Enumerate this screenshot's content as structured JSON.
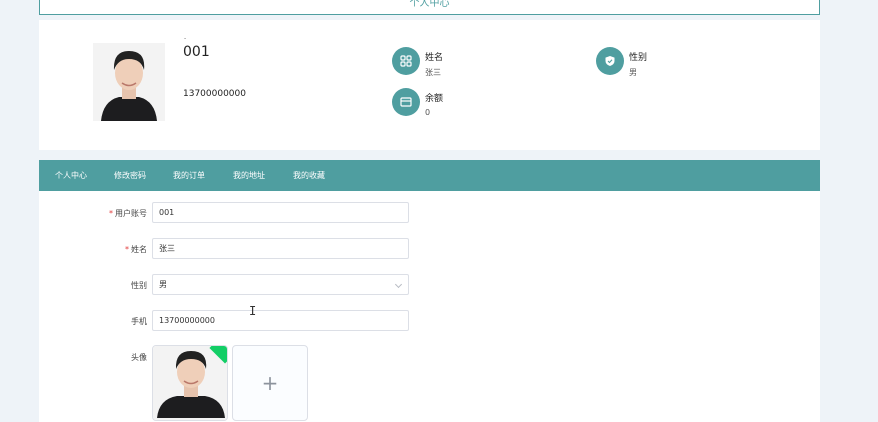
{
  "header": {
    "title": "个人中心"
  },
  "profile": {
    "mark": "-",
    "account": "001",
    "phone": "13700000000",
    "info": [
      {
        "label": "姓名",
        "value": "张三",
        "icon": "grid-icon"
      },
      {
        "label": "性别",
        "value": "男",
        "icon": "shield-icon"
      },
      {
        "label": "余额",
        "value": "0",
        "icon": "wallet-icon"
      }
    ]
  },
  "tabs": [
    {
      "label": "个人中心"
    },
    {
      "label": "修改密码"
    },
    {
      "label": "我的订单"
    },
    {
      "label": "我的地址"
    },
    {
      "label": "我的收藏"
    }
  ],
  "form": {
    "account": {
      "label": "用户账号",
      "value": "001",
      "required": "*"
    },
    "name": {
      "label": "姓名",
      "value": "张三",
      "required": "*"
    },
    "gender": {
      "label": "性别",
      "value": "男"
    },
    "phone": {
      "label": "手机",
      "value": "13700000000"
    },
    "avatar": {
      "label": "头像",
      "add": "+"
    }
  },
  "colors": {
    "accent": "#4f9ea0",
    "required": "#e23c3c",
    "success": "#13ce66"
  }
}
